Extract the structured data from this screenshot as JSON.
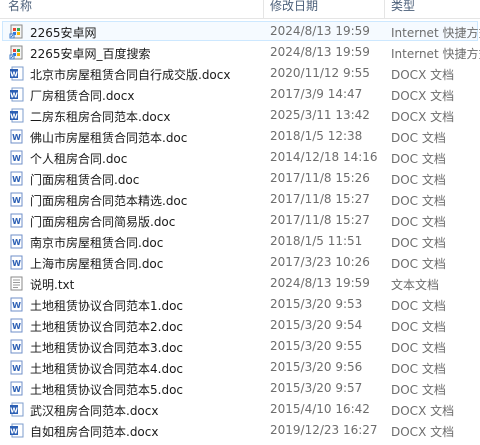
{
  "columns": {
    "name": "名称",
    "date": "修改日期",
    "type": "类型"
  },
  "files": [
    {
      "name": "2265安卓网",
      "date": "2024/8/13 19:59",
      "type": "Internet 快捷方式",
      "icon": "url-shortcut-icon",
      "selected": true
    },
    {
      "name": "2265安卓网_百度搜索",
      "date": "2024/8/13 19:59",
      "type": "Internet 快捷方式",
      "icon": "url-shortcut-icon"
    },
    {
      "name": "北京市房屋租赁合同自行成交版.docx",
      "date": "2020/11/12 9:55",
      "type": "DOCX 文档",
      "icon": "word-docx-icon"
    },
    {
      "name": "厂房租赁合同.docx",
      "date": "2017/3/9 14:47",
      "type": "DOCX 文档",
      "icon": "word-docx-icon"
    },
    {
      "name": "二房东租房合同范本.docx",
      "date": "2025/3/11 13:42",
      "type": "DOCX 文档",
      "icon": "word-docx-icon"
    },
    {
      "name": "佛山市房屋租赁合同范本.doc",
      "date": "2018/1/5 12:38",
      "type": "DOC 文档",
      "icon": "word-doc-icon"
    },
    {
      "name": "个人租房合同.doc",
      "date": "2014/12/18 14:16",
      "type": "DOC 文档",
      "icon": "word-doc-icon"
    },
    {
      "name": "门面房租赁合同.doc",
      "date": "2017/11/8 15:26",
      "type": "DOC 文档",
      "icon": "word-doc-icon"
    },
    {
      "name": "门面房租房合同范本精选.doc",
      "date": "2017/11/8 15:27",
      "type": "DOC 文档",
      "icon": "word-doc-icon"
    },
    {
      "name": "门面房租房合同简易版.doc",
      "date": "2017/11/8 15:27",
      "type": "DOC 文档",
      "icon": "word-doc-icon"
    },
    {
      "name": "南京市房屋租赁合同.doc",
      "date": "2018/1/5 11:51",
      "type": "DOC 文档",
      "icon": "word-doc-icon"
    },
    {
      "name": "上海市房屋租赁合同.doc",
      "date": "2017/3/23 10:26",
      "type": "DOC 文档",
      "icon": "word-doc-icon"
    },
    {
      "name": "说明.txt",
      "date": "2024/8/13 19:59",
      "type": "文本文档",
      "icon": "text-file-icon"
    },
    {
      "name": "土地租赁协议合同范本1.doc",
      "date": "2015/3/20 9:53",
      "type": "DOC 文档",
      "icon": "word-doc-icon"
    },
    {
      "name": "土地租赁协议合同范本2.doc",
      "date": "2015/3/20 9:54",
      "type": "DOC 文档",
      "icon": "word-doc-icon"
    },
    {
      "name": "土地租赁协议合同范本3.doc",
      "date": "2015/3/20 9:55",
      "type": "DOC 文档",
      "icon": "word-doc-icon"
    },
    {
      "name": "土地租赁协议合同范本4.doc",
      "date": "2015/3/20 9:56",
      "type": "DOC 文档",
      "icon": "word-doc-icon"
    },
    {
      "name": "土地租赁协议合同范本5.doc",
      "date": "2015/3/20 9:57",
      "type": "DOC 文档",
      "icon": "word-doc-icon"
    },
    {
      "name": "武汉租房合同范本.docx",
      "date": "2015/4/10 16:42",
      "type": "DOCX 文档",
      "icon": "word-docx-icon"
    },
    {
      "name": "自如租房合同范本.docx",
      "date": "2019/12/23 16:27",
      "type": "DOCX 文档",
      "icon": "word-docx-icon"
    }
  ]
}
